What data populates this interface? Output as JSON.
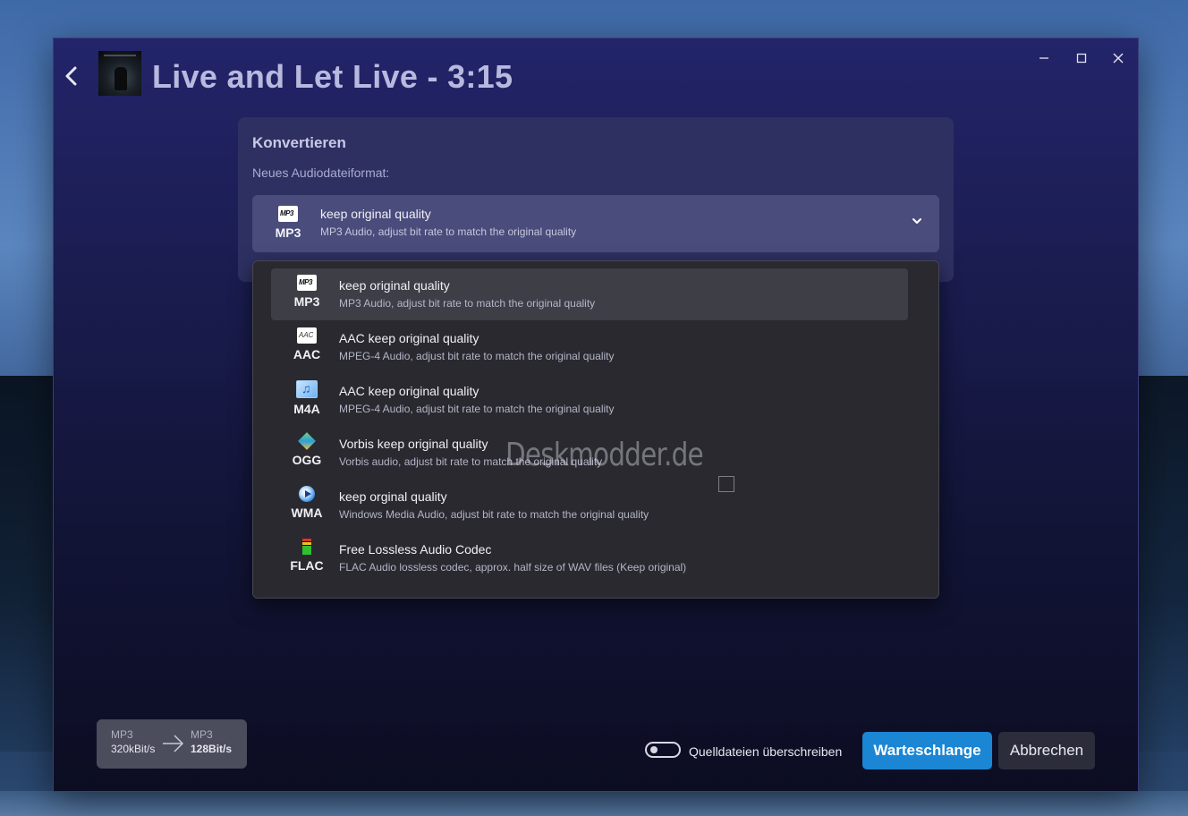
{
  "window": {
    "title": "Live and Let Live - 3:15",
    "controls": {
      "minimize": "—",
      "maximize": "☐",
      "close": "✕"
    }
  },
  "panel": {
    "title": "Konvertieren",
    "label": "Neues Audiodateiformat:"
  },
  "combo": {
    "selected": {
      "code": "MP3",
      "icon": "mp3-icon",
      "title": "keep original quality",
      "subtitle": "MP3 Audio, adjust bit rate to match the original quality"
    }
  },
  "dropdown": {
    "options": [
      {
        "code": "MP3",
        "icon": "mp3-icon",
        "title": "keep original quality",
        "subtitle": "MP3 Audio, adjust bit rate to match the original quality",
        "selected": true
      },
      {
        "code": "AAC",
        "icon": "aac-icon",
        "title": "AAC keep original quality",
        "subtitle": "MPEG-4 Audio, adjust bit rate to match the original quality"
      },
      {
        "code": "M4A",
        "icon": "m4a-icon",
        "title": "AAC keep original quality",
        "subtitle": "MPEG-4 Audio, adjust bit rate to match the original quality"
      },
      {
        "code": "OGG",
        "icon": "ogg-icon",
        "title": "Vorbis keep original quality",
        "subtitle": "Vorbis audio, adjust bit rate to match the original quality"
      },
      {
        "code": "WMA",
        "icon": "wma-icon",
        "title": "keep orginal quality",
        "subtitle": "Windows Media Audio, adjust bit rate to match the original quality"
      },
      {
        "code": "FLAC",
        "icon": "flac-icon",
        "title": "Free Lossless Audio Codec",
        "subtitle": "FLAC Audio lossless codec, approx. half size of WAV files (Keep original)"
      }
    ]
  },
  "watermark": "Deskmodder.de",
  "bitrate": {
    "from_format": "MP3",
    "from_rate": "320kBit/s",
    "to_format": "MP3",
    "to_rate": "128Bit/s"
  },
  "overwrite": {
    "label": "Quelldateien überschreiben",
    "enabled": false
  },
  "buttons": {
    "queue": "Warteschlange",
    "cancel": "Abbrechen"
  },
  "colors": {
    "accent": "#1b86d4",
    "window_top": "#23246a",
    "dropdown_bg": "#29292f"
  }
}
